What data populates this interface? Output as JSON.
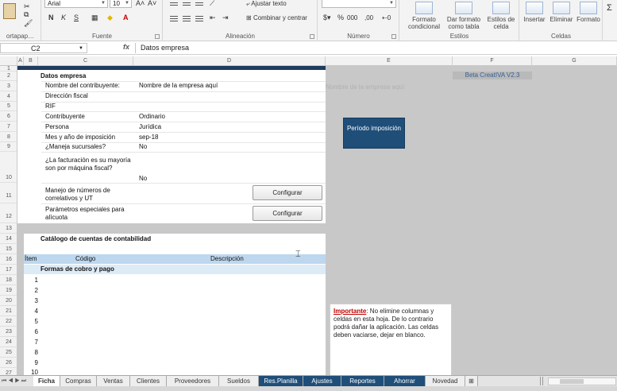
{
  "ribbon": {
    "font_name": "Arial",
    "font_size": "10",
    "bold": "N",
    "italic": "K",
    "underline": "S",
    "group_clipboard": "ortapap…",
    "group_font": "Fuente",
    "group_alignment": "Alineación",
    "group_number": "Número",
    "group_styles": "Estilos",
    "group_cells": "Celdas",
    "wrap_text": "Ajustar texto",
    "merge_center": "Combinar y centrar",
    "percent": "%",
    "thousands": "000",
    "decimals": ",00",
    "cond_format": "Formato condicional",
    "table_format": "Dar formato como tabla",
    "cell_styles": "Estilos de celda",
    "insert": "Insertar",
    "delete": "Eliminar",
    "format": "Formato"
  },
  "formula_bar": {
    "name_box": "C2",
    "fx": "fx",
    "content": "Datos empresa"
  },
  "columns": [
    "A",
    "B",
    "C",
    "D",
    "E",
    "F",
    "G"
  ],
  "rows": [
    "1",
    "2",
    "3",
    "4",
    "5",
    "6",
    "7",
    "8",
    "9",
    "10",
    "11",
    "12",
    "13",
    "14",
    "15",
    "16",
    "17",
    "18",
    "19",
    "20",
    "21",
    "22",
    "23",
    "24",
    "25",
    "26",
    "27"
  ],
  "sheet": {
    "section_title": "Datos empresa",
    "fields": [
      {
        "label": "Nombre del contribuyente:",
        "value": "Nombre de la empresa aquí"
      },
      {
        "label": "Dirección fiscal",
        "value": ""
      },
      {
        "label": "RIF",
        "value": ""
      },
      {
        "label": "Contribuyente",
        "value": "Ordinario"
      },
      {
        "label": "Persona",
        "value": "Jurídica"
      },
      {
        "label": "Mes y año de imposición",
        "value": "sep-18"
      },
      {
        "label": "¿Maneja sucursales?",
        "value": "No"
      },
      {
        "label": "¿La facturación es su mayoría son por máquina fiscal?",
        "value": "No"
      },
      {
        "label": "Manejo de números de correlativos y UT",
        "value": ""
      },
      {
        "label": "Parámetros especiales para alícuota",
        "value": ""
      }
    ],
    "configure_button": "Configurar",
    "catalog_title": "Catálogo de cuentas de contabilidad",
    "catalog_headers": [
      "Ítem",
      "Código",
      "Descripción"
    ],
    "catalog_group": "Formas de cobro y pago",
    "catalog_items": [
      "1",
      "2",
      "3",
      "4",
      "5",
      "6",
      "7",
      "8",
      "9",
      "10"
    ],
    "version_badge": "Beta CreatIVA V2.3",
    "ghost_text": "Nombre de la empresa aquí",
    "periodo_button": "Período imposición",
    "note_important": "Importante",
    "note_text": ": No elimine columnas y celdas en esta hoja. De lo contrario podrá dañar la aplicación. Las celdas deben vaciarse, dejar en blanco."
  },
  "tabs": [
    "Ficha",
    "Compras",
    "Ventas",
    "Clientes",
    "Proveedores",
    "Sueldos",
    "Res.Planilla",
    "Ajustes",
    "Reportes",
    "Ahorrar",
    "Novedad"
  ],
  "active_tab": "Ficha"
}
